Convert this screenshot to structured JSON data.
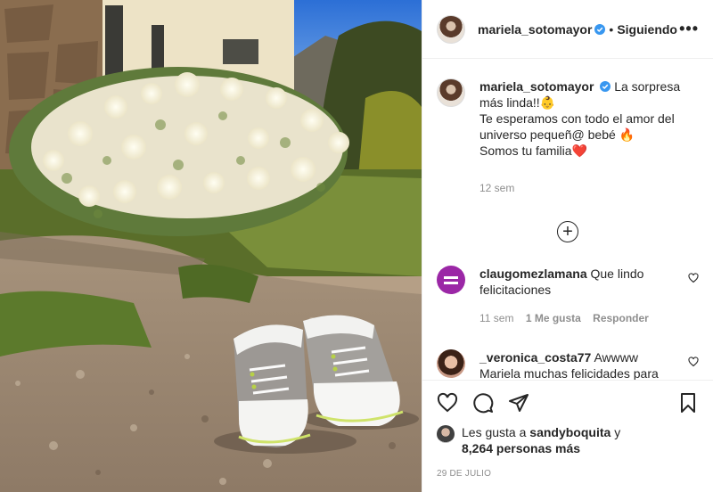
{
  "post": {
    "author": "mariela_sotomayor",
    "follow_status": "Siguiendo",
    "more_label": "•••",
    "caption": {
      "line1": "La sorpresa más linda!!👶",
      "line2": "Te esperamos con todo el amor del universo pequeñ@ bebé 🔥",
      "line3": "Somos tu familia❤️"
    },
    "caption_age": "12 sem",
    "load_more_label": "+"
  },
  "comments": [
    {
      "username": "claugomezlamana",
      "text": "Que lindo felicitaciones",
      "age": "11 sem",
      "likes": "1 Me gusta",
      "reply": "Responder"
    },
    {
      "username": "_veronica_costa77",
      "text": "Awwww Mariela muchas felicidades para ti y familia.... Siempre siempre es",
      "age": "",
      "likes": "",
      "reply": ""
    }
  ],
  "likes": {
    "prefix": "Les gusta a",
    "user": "sandyboquita",
    "connector": "y",
    "count": "8,264 personas más"
  },
  "date": "29 DE JULIO",
  "colors": {
    "verified": "#3897f0",
    "muted": "#8e8e8e",
    "text": "#262626",
    "avatar_purple": "#9b27a6"
  },
  "icons": [
    "verified-badge-icon",
    "more-options-icon",
    "load-more-plus-icon",
    "heart-icon",
    "comment-icon",
    "share-icon",
    "bookmark-icon"
  ]
}
